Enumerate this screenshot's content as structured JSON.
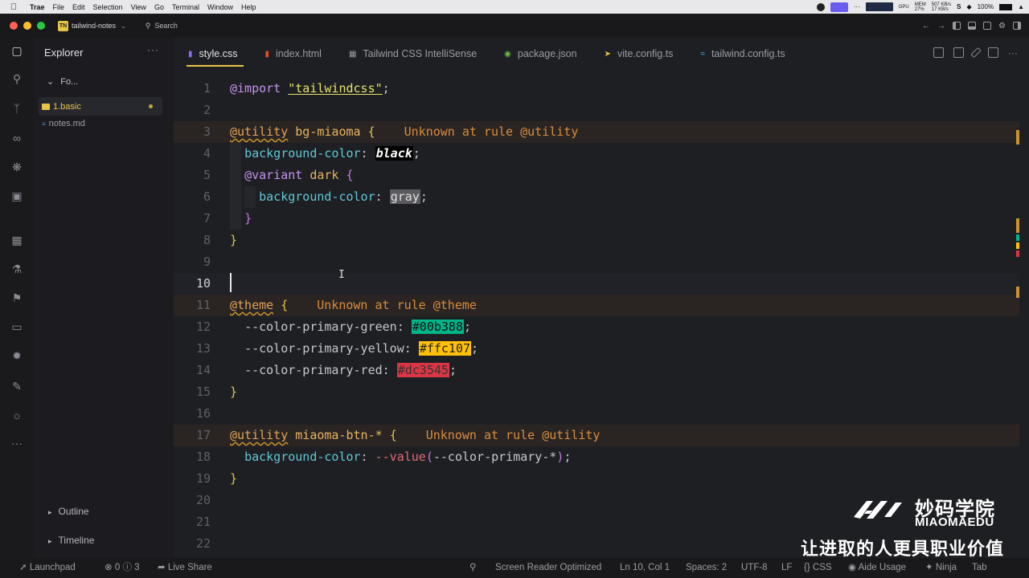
{
  "menubar": {
    "app": "Trae",
    "items": [
      "File",
      "Edit",
      "Selection",
      "View",
      "Go",
      "Terminal",
      "Window",
      "Help"
    ],
    "gpu_label": "GPU",
    "mem_label": "MEM",
    "mem_value": "27%",
    "net_up": "507 KB/s",
    "net_down": "17 KB/s",
    "battery": "100%"
  },
  "titlebar": {
    "project_badge": "TN",
    "project_name": "tailwind-notes",
    "search_label": "Search"
  },
  "sidebar": {
    "title": "Explorer",
    "folder": "Fo...",
    "files": [
      "1.basic",
      "notes.md"
    ],
    "sections": [
      "Outline",
      "Timeline"
    ]
  },
  "tabs": [
    {
      "label": "style.css",
      "icon": "css-file-icon",
      "color": "#8a6cf0"
    },
    {
      "label": "index.html",
      "icon": "html-file-icon",
      "color": "#e44d26"
    },
    {
      "label": "Tailwind CSS IntelliSense",
      "icon": "extension-icon",
      "color": "#c8c8cc"
    },
    {
      "label": "package.json",
      "icon": "npm-package-icon",
      "color": "#6cbf43"
    },
    {
      "label": "vite.config.ts",
      "icon": "vite-icon",
      "color": "#e8c547"
    },
    {
      "label": "tailwind.config.ts",
      "icon": "tailwind-icon",
      "color": "#38bdf8"
    }
  ],
  "code": {
    "l1_kw": "@import",
    "l1_str": "\"tailwindcss\"",
    "l3_kw": "@utility",
    "l3_sel": "bg-miaoma",
    "l3_diag": "Unknown at rule @utility",
    "l4_prop": "background-color",
    "l4_val": "black",
    "l5_kw": "@variant",
    "l5_sel": "dark",
    "l6_prop": "background-color",
    "l6_val": "gray",
    "l11_kw": "@theme",
    "l11_diag": "Unknown at rule @theme",
    "l12_prop": "--color-primary-green",
    "l12_val": "#00b388",
    "l13_prop": "--color-primary-yellow",
    "l13_val": "#ffc107",
    "l14_prop": "--color-primary-red",
    "l14_val": "#dc3545",
    "l17_kw": "@utility",
    "l17_sel": "miaoma-btn-*",
    "l17_diag": "Unknown at rule @utility",
    "l18_prop": "background-color",
    "l18_fn": "--value",
    "l18_arg": "--color-primary-*",
    "line_numbers": [
      "1",
      "2",
      "3",
      "4",
      "5",
      "6",
      "7",
      "8",
      "9",
      "10",
      "11",
      "12",
      "13",
      "14",
      "15",
      "16",
      "17",
      "18",
      "19",
      "20",
      "21",
      "22"
    ]
  },
  "status": {
    "launchpad": "Launchpad",
    "errors": "0",
    "warnings": "3",
    "live_share": "Live Share",
    "screen_reader": "Screen Reader Optimized",
    "position": "Ln 10, Col 1",
    "spaces": "Spaces: 2",
    "encoding": "UTF-8",
    "eol": "LF",
    "language": "CSS",
    "aide": "Aide Usage",
    "ninja": "Ninja",
    "tab": "Tab"
  },
  "watermark": {
    "cn_name": "妙码学院",
    "en_name": "MIAOMAEDU",
    "slogan": "让进取的人更具职业价值"
  },
  "colors": {
    "accent": "#e8c547",
    "warning": "#d98c3d",
    "green": "#00b388",
    "yellow": "#ffc107",
    "red": "#dc3545"
  }
}
